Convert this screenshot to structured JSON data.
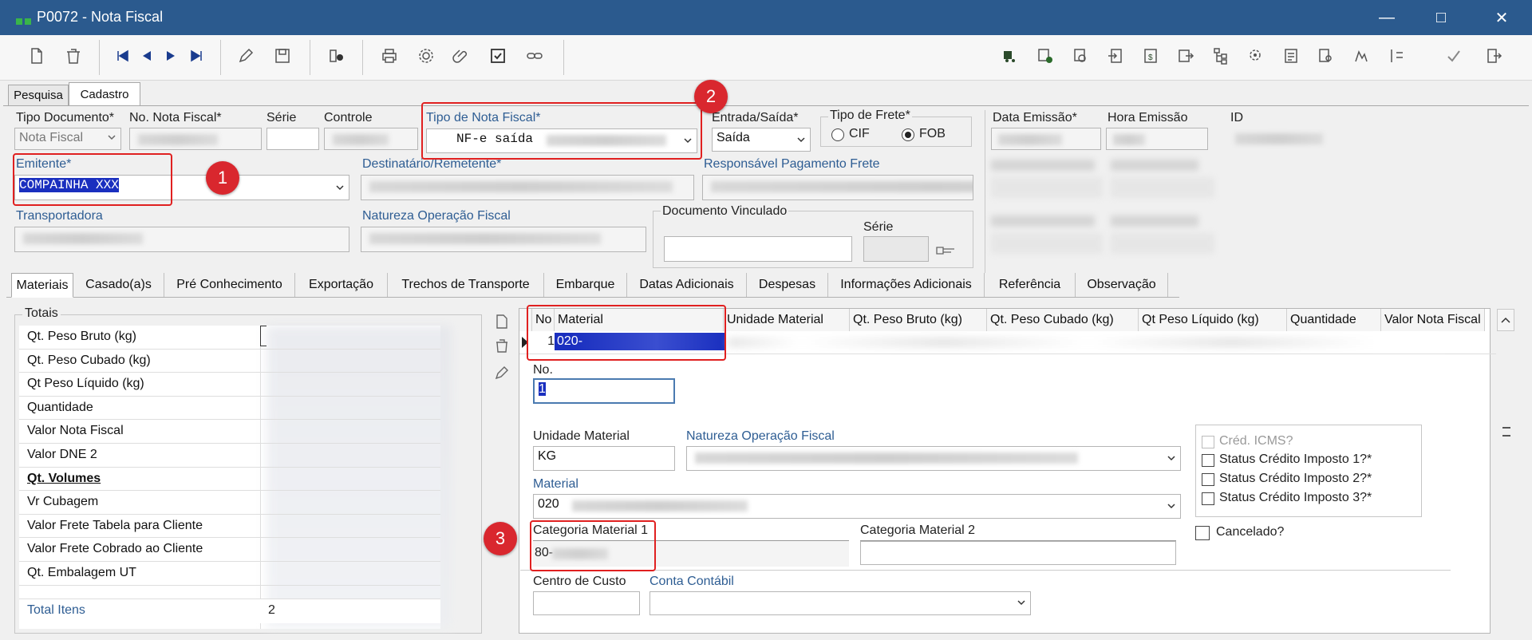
{
  "window": {
    "title": "P0072 - Nota Fiscal",
    "minimize": "—",
    "maximize": "□",
    "close": "✕"
  },
  "main_tabs": [
    "Pesquisa",
    "Cadastro"
  ],
  "header": {
    "tipo_documento": {
      "label": "Tipo Documento*",
      "value": "Nota Fiscal"
    },
    "numero_nota": {
      "label": "No. Nota Fiscal*"
    },
    "serie": {
      "label": "Série"
    },
    "controle": {
      "label": "Controle"
    },
    "tipo_nota": {
      "label": "Tipo de Nota Fiscal*",
      "value": "NF-e saída"
    },
    "entrada_saida": {
      "label": "Entrada/Saída*",
      "value": "Saída"
    },
    "tipo_frete": {
      "label": "Tipo de Frete*",
      "options": [
        "CIF",
        "FOB"
      ],
      "selected": "FOB"
    },
    "data_emissao": {
      "label": "Data Emissão*"
    },
    "hora_emissao": {
      "label": "Hora Emissão"
    },
    "id": {
      "label": "ID"
    },
    "emitente": {
      "label": "Emitente*",
      "value": "COMPAINHA XXX"
    },
    "destinatario": {
      "label": "Destinatário/Remetente*"
    },
    "responsavel_frete": {
      "label": "Responsável Pagamento Frete"
    },
    "transportadora": {
      "label": "Transportadora"
    },
    "natureza_operacao": {
      "label": "Natureza Operação Fiscal"
    },
    "documento_vinculado": {
      "label": "Documento Vinculado",
      "serie_label": "Série"
    }
  },
  "sub_tabs": [
    "Materiais",
    "Casado(a)s",
    "Pré Conhecimento",
    "Exportação",
    "Trechos de Transporte",
    "Embarque",
    "Datas Adicionais",
    "Despesas",
    "Informações Adicionais",
    "Referência",
    "Observação"
  ],
  "totais": {
    "title": "Totais",
    "rows": [
      "Qt. Peso Bruto (kg)",
      "Qt. Peso Cubado (kg)",
      "Qt Peso Líquido (kg)",
      "Quantidade",
      "Valor Nota Fiscal",
      "Valor DNE 2",
      "Qt. Volumes",
      "Vr Cubagem",
      "Valor Frete Tabela para Cliente",
      "Valor Frete Cobrado ao Cliente",
      "Qt. Embalagem UT"
    ],
    "total_itens_label": "Total Itens",
    "total_itens_value": "2"
  },
  "grid": {
    "columns": [
      "No",
      "Material",
      "Unidade Material",
      "Qt. Peso Bruto (kg)",
      "Qt. Peso Cubado (kg)",
      "Qt Peso Líquido (kg)",
      "Quantidade",
      "Valor Nota Fiscal"
    ],
    "row": {
      "no": "1",
      "material": "020-"
    }
  },
  "detail": {
    "no": {
      "label": "No.",
      "value": "1"
    },
    "unidade": {
      "label": "Unidade Material",
      "value": "KG"
    },
    "natureza": {
      "label": "Natureza Operação Fiscal"
    },
    "material": {
      "label": "Material",
      "value": "020"
    },
    "categoria1": {
      "label": "Categoria Material 1",
      "value": "80-"
    },
    "categoria2": {
      "label": "Categoria Material 2"
    },
    "centro_custo": {
      "label": "Centro de Custo"
    },
    "conta_contabil": {
      "label": "Conta Contábil"
    },
    "checks": [
      "Créd. ICMS?",
      "Status Crédito Imposto 1?*",
      "Status Crédito Imposto 2?*",
      "Status Crédito Imposto 3?*"
    ],
    "cancelado": "Cancelado?"
  },
  "callouts": [
    "1",
    "2",
    "3"
  ],
  "colors": {
    "titlebar": "#2b5a8e",
    "callout": "#e02020",
    "badge": "#d9272e",
    "selection": "#1a2fbf"
  }
}
